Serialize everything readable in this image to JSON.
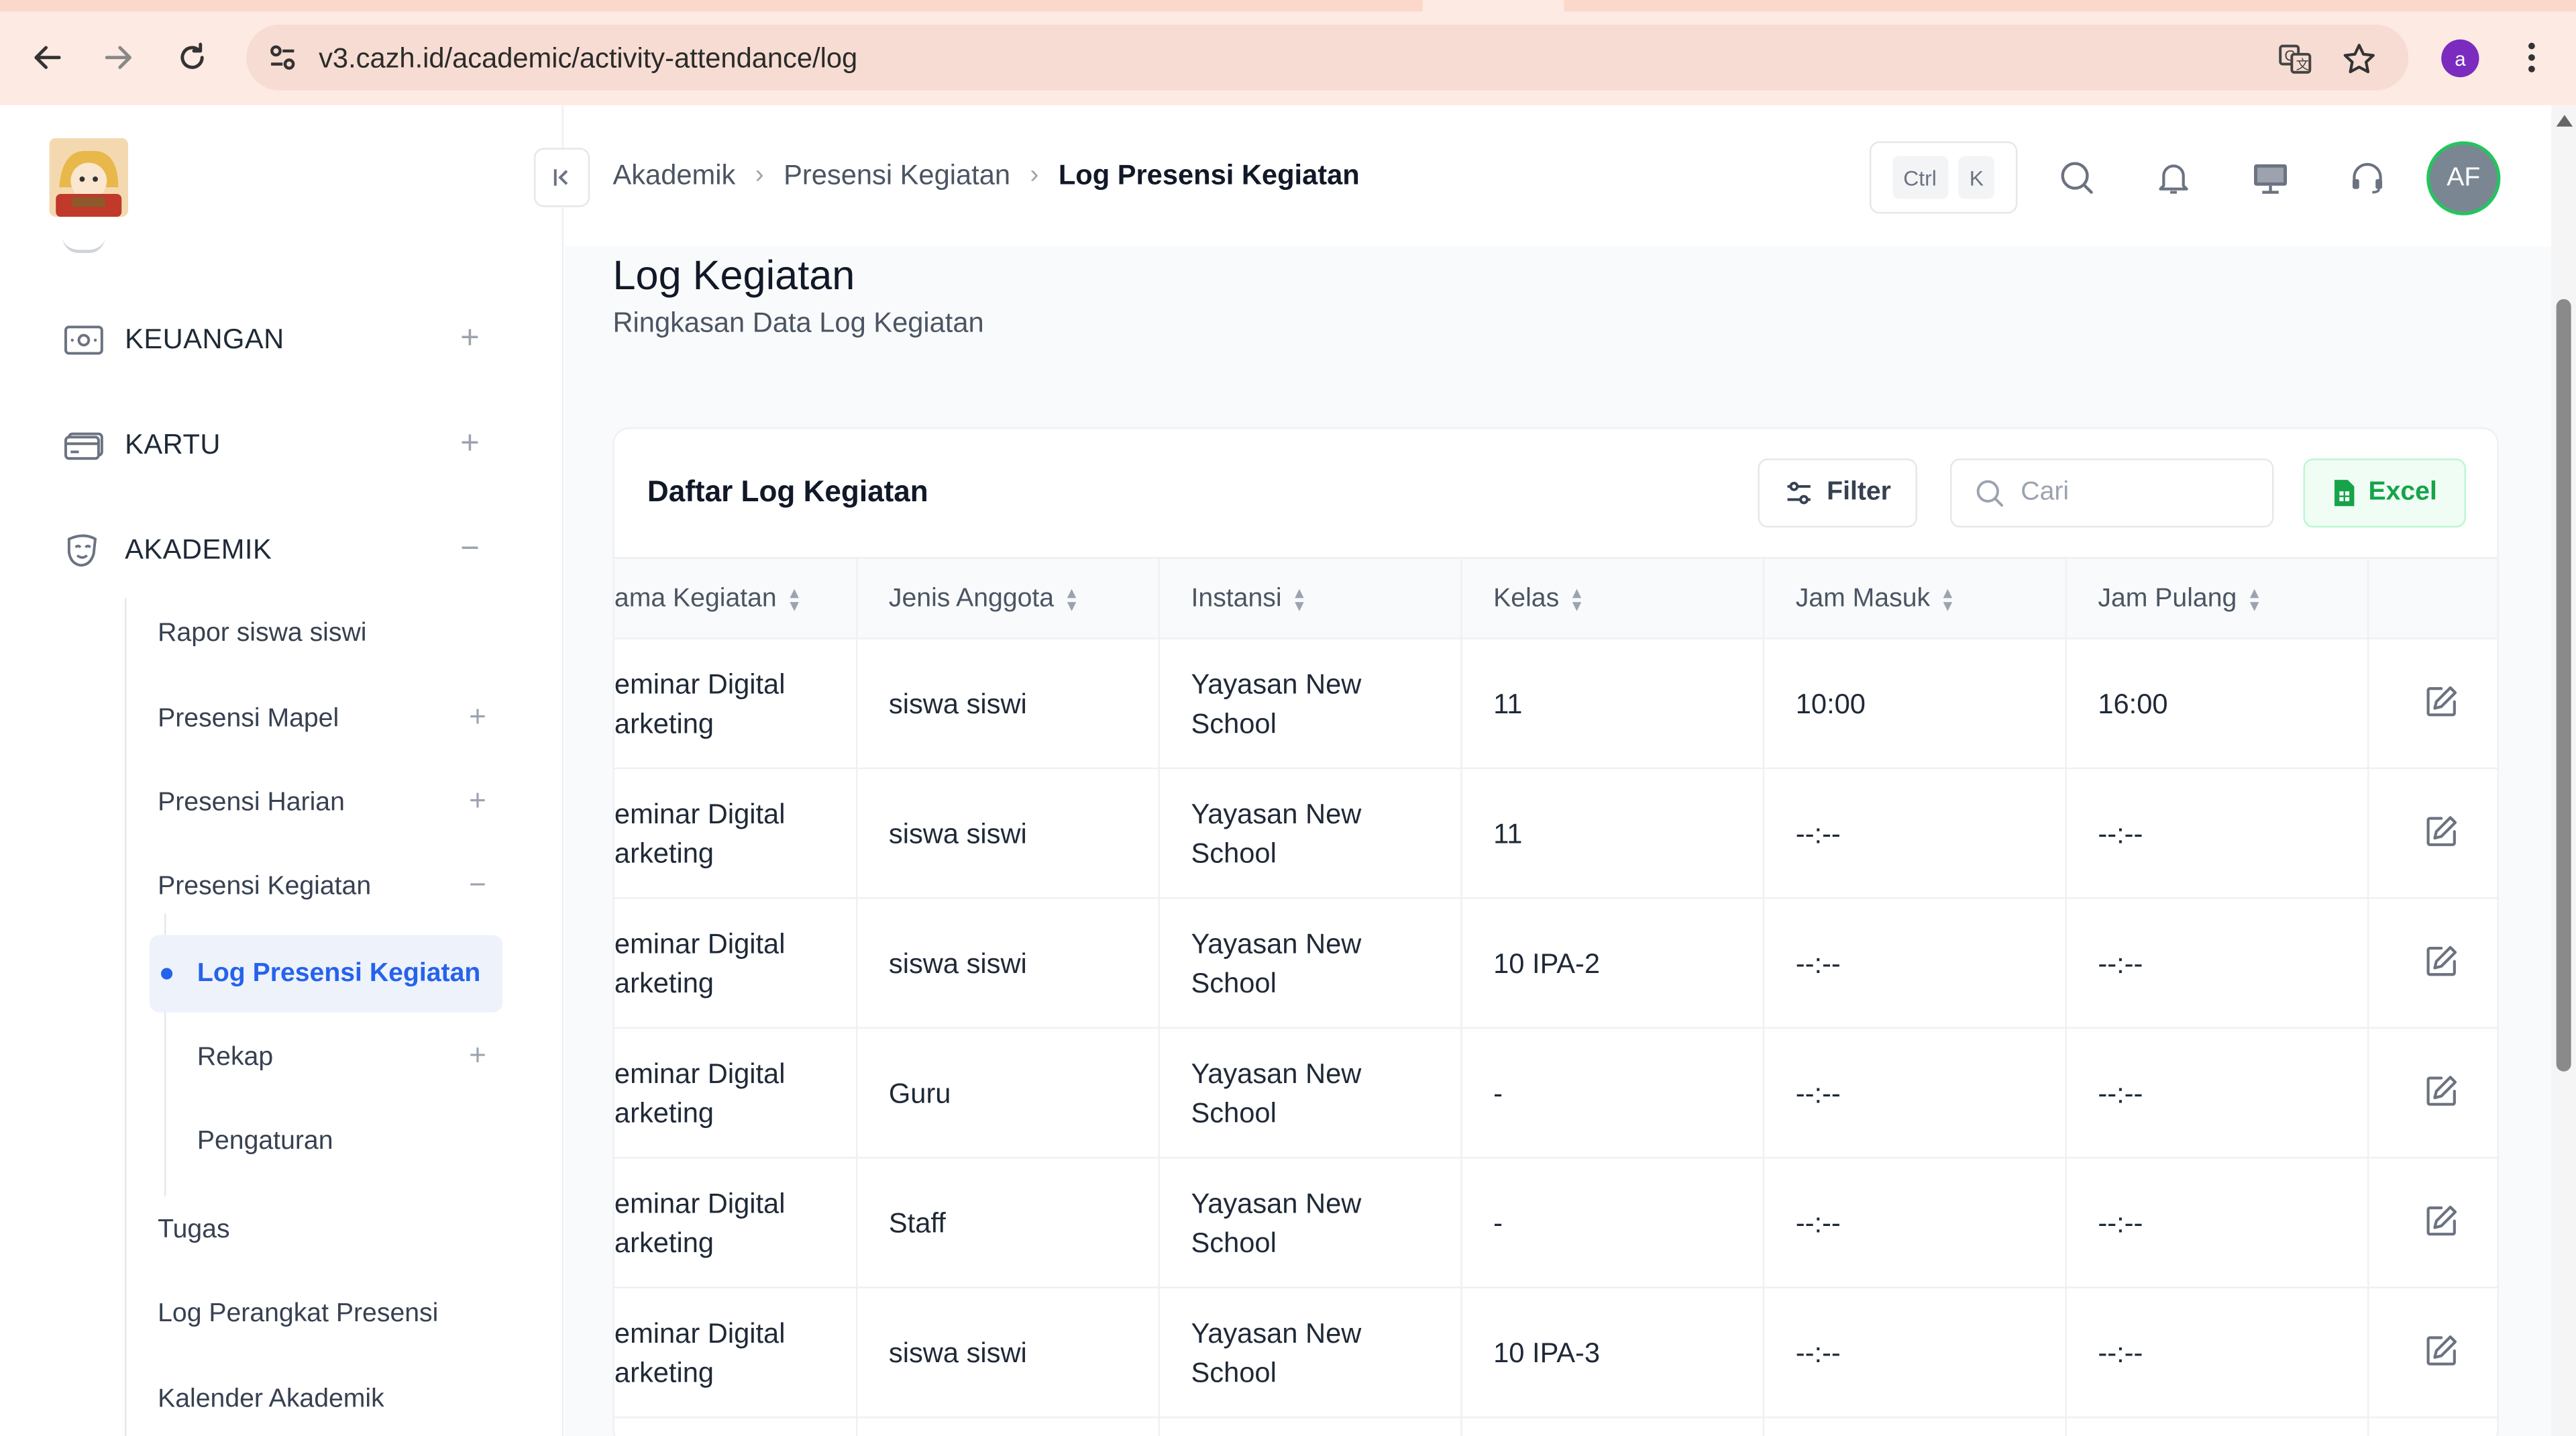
{
  "browser": {
    "url": "v3.cazh.id/academic/activity-attendance/log",
    "profile_initial": "a"
  },
  "sidebar": {
    "items": [
      {
        "label": "KEUANGAN",
        "expander": "+"
      },
      {
        "label": "KARTU",
        "expander": "+"
      },
      {
        "label": "AKADEMIK",
        "expander": "−"
      }
    ],
    "akademik_children": [
      {
        "label": "Rapor siswa siswi",
        "expander": ""
      },
      {
        "label": "Presensi Mapel",
        "expander": "+"
      },
      {
        "label": "Presensi Harian",
        "expander": "+"
      },
      {
        "label": "Presensi Kegiatan",
        "expander": "−"
      }
    ],
    "kegiatan_children": {
      "active": "Log Presensi Kegiatan",
      "items": [
        {
          "label": "Rekap",
          "expander": "+"
        },
        {
          "label": "Pengaturan",
          "expander": ""
        }
      ]
    },
    "akademik_more": [
      {
        "label": "Tugas"
      },
      {
        "label": "Log Perangkat Presensi"
      },
      {
        "label": "Kalender Akademik"
      }
    ]
  },
  "header": {
    "breadcrumb": [
      "Akademik",
      "Presensi Kegiatan",
      "Log Presensi Kegiatan"
    ],
    "kbd": [
      "Ctrl",
      "K"
    ],
    "avatar": "AF"
  },
  "page": {
    "title": "Log Kegiatan",
    "subtitle": "Ringkasan Data Log Kegiatan"
  },
  "card": {
    "title": "Daftar Log Kegiatan",
    "filter_label": "Filter",
    "search_placeholder": "Cari",
    "excel_label": "Excel"
  },
  "table": {
    "columns": [
      "ama Kegiatan",
      "Jenis Anggota",
      "Instansi",
      "Kelas",
      "Jam Masuk",
      "Jam Pulang"
    ],
    "rows": [
      {
        "kegiatan": "eminar Digital\narketing",
        "jenis": "siswa siswi",
        "instansi": "Yayasan New\nSchool",
        "kelas": "11",
        "masuk": "10:00",
        "pulang": "16:00"
      },
      {
        "kegiatan": "eminar Digital\narketing",
        "jenis": "siswa siswi",
        "instansi": "Yayasan New\nSchool",
        "kelas": "11",
        "masuk": "--:--",
        "pulang": "--:--"
      },
      {
        "kegiatan": "eminar Digital\narketing",
        "jenis": "siswa siswi",
        "instansi": "Yayasan New\nSchool",
        "kelas": "10 IPA-2",
        "masuk": "--:--",
        "pulang": "--:--"
      },
      {
        "kegiatan": "eminar Digital\narketing",
        "jenis": "Guru",
        "instansi": "Yayasan New\nSchool",
        "kelas": "-",
        "masuk": "--:--",
        "pulang": "--:--"
      },
      {
        "kegiatan": "eminar Digital\narketing",
        "jenis": "Staff",
        "instansi": "Yayasan New\nSchool",
        "kelas": "-",
        "masuk": "--:--",
        "pulang": "--:--"
      },
      {
        "kegiatan": "eminar Digital\narketing",
        "jenis": "siswa siswi",
        "instansi": "Yayasan New\nSchool",
        "kelas": "10 IPA-3",
        "masuk": "--:--",
        "pulang": "--:--"
      }
    ]
  },
  "colors": {
    "accent": "#2563eb",
    "excel_green": "#16a34a",
    "avatar_ring": "#22c55e"
  }
}
